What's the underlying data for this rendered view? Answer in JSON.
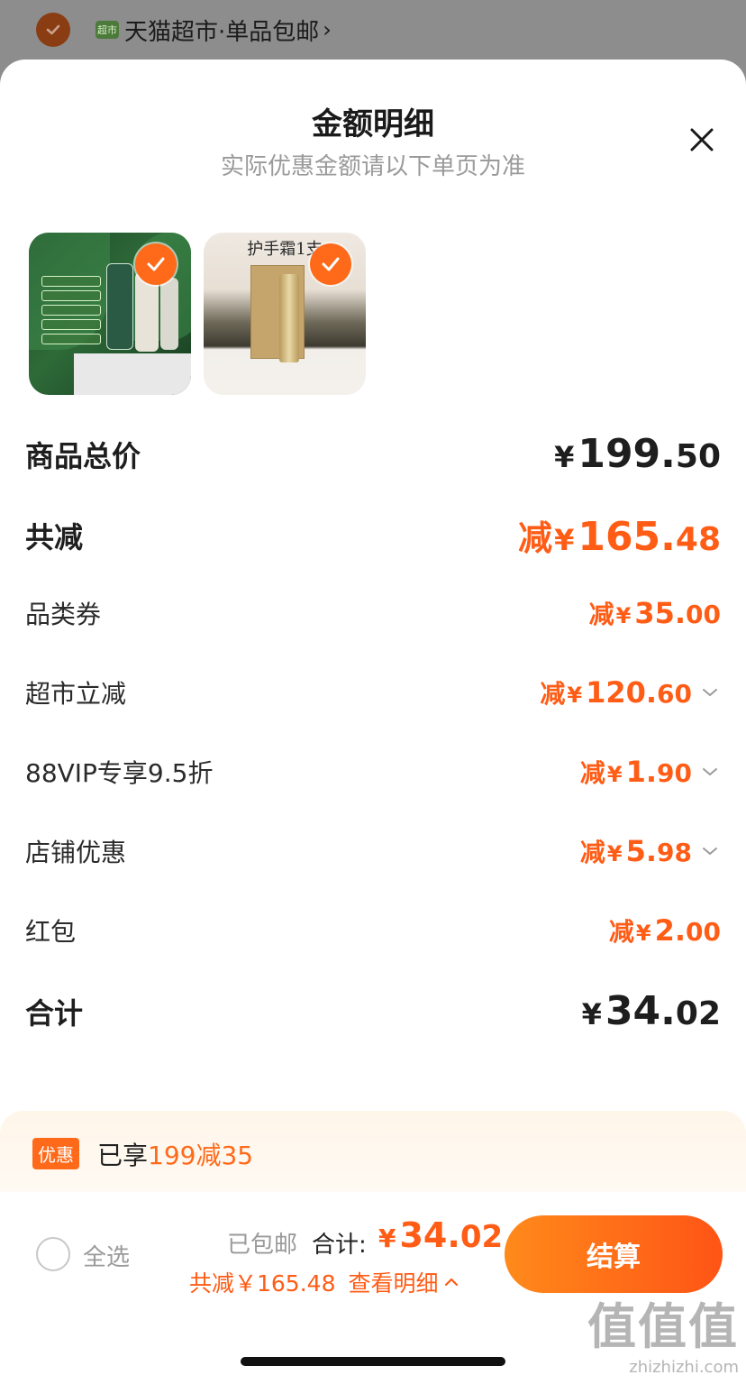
{
  "topbar": {
    "badge": "超市",
    "store_name": "天猫超市·单品包邮",
    "chevron": "›"
  },
  "sheet": {
    "title": "金额明细",
    "subtitle": "实际优惠金额请以下单页为准"
  },
  "products": [
    {
      "name": "toothpaste",
      "selected": true
    },
    {
      "name": "hand-cream",
      "selected": true,
      "banner": "护手霜1支"
    }
  ],
  "rows": {
    "total_goods": {
      "label": "商品总价",
      "yen": "¥",
      "int": "199.",
      "dec": "50"
    },
    "total_reduce": {
      "label": "共减",
      "pre": "减",
      "yen": "¥",
      "int": "165.",
      "dec": "48"
    },
    "category_coupon": {
      "label": "品类券",
      "pre": "减",
      "yen": "¥",
      "int": "35.",
      "dec": "00"
    },
    "supermarket_off": {
      "label": "超市立减",
      "pre": "减",
      "yen": "¥",
      "int": "120.",
      "dec": "60"
    },
    "vip": {
      "label": "88VIP专享9.5折",
      "pre": "减",
      "yen": "¥",
      "int": "1.",
      "dec": "90"
    },
    "store_discount": {
      "label": "店铺优惠",
      "pre": "减",
      "yen": "¥",
      "int": "5.",
      "dec": "98"
    },
    "red_packet": {
      "label": "红包",
      "pre": "减",
      "yen": "¥",
      "int": "2.",
      "dec": "00"
    },
    "grand_total": {
      "label": "合计",
      "yen": "¥",
      "int": "34.",
      "dec": "02"
    }
  },
  "promo": {
    "tag": "优惠",
    "text_prefix": "已享",
    "text_highlight": "199减35"
  },
  "footer": {
    "select_all": "全选",
    "shipping": "已包邮",
    "total_label": "合计:",
    "total_yen": "¥",
    "total_int": "34.",
    "total_dec": "02",
    "saved_text": "共减￥165.48",
    "detail_link": "查看明细",
    "checkout": "结算"
  },
  "watermark": {
    "line1": "值值值",
    "line2": "zhizhizhi.com"
  },
  "colors": {
    "accent": "#ff5c16",
    "accent_light": "#ff8a1a",
    "text": "#1e1e1e",
    "muted": "#9a9a9a"
  }
}
